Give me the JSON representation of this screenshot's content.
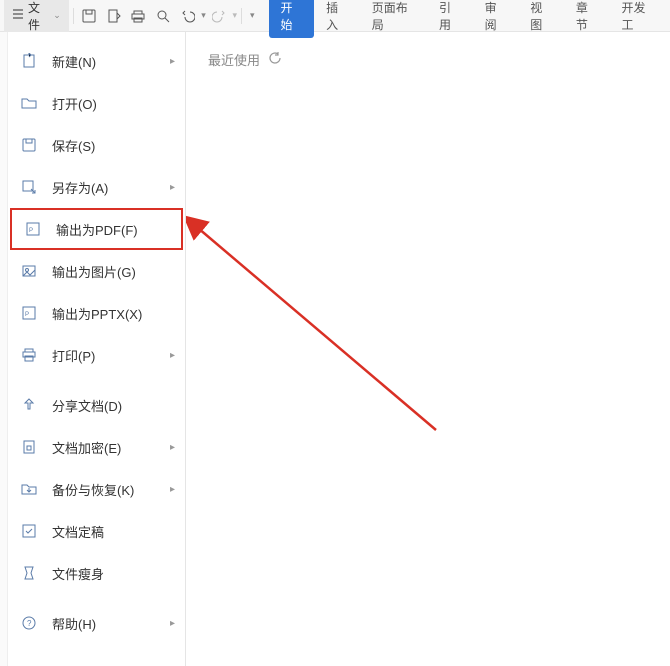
{
  "titlebar": {
    "file_label": "文件"
  },
  "tabs": {
    "start": "开始",
    "insert": "插入",
    "pagelayout": "页面布局",
    "references": "引用",
    "review": "审阅",
    "view": "视图",
    "chapter": "章节",
    "dev": "开发工"
  },
  "menu": {
    "new": "新建(N)",
    "open": "打开(O)",
    "save": "保存(S)",
    "saveas": "另存为(A)",
    "exportpdf": "输出为PDF(F)",
    "exportimg": "输出为图片(G)",
    "exportpptx": "输出为PPTX(X)",
    "print": "打印(P)",
    "share": "分享文档(D)",
    "encrypt": "文档加密(E)",
    "backup": "备份与恢复(K)",
    "finalize": "文档定稿",
    "slim": "文件瘦身",
    "help": "帮助(H)"
  },
  "content": {
    "recent_label": "最近使用"
  }
}
